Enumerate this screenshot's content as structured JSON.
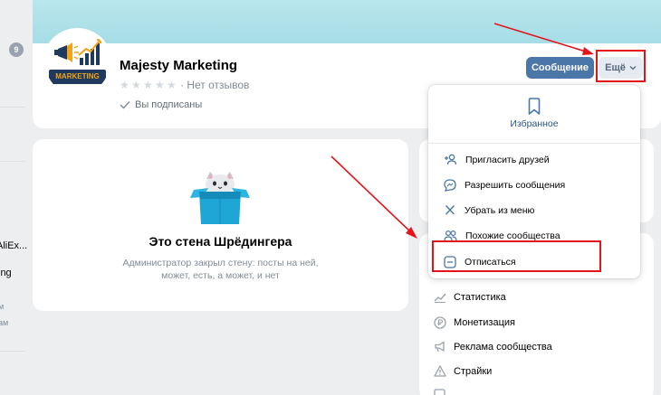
{
  "sidebar": {
    "badge": "9",
    "items": [
      {
        "text": "AliEx..."
      },
      {
        "text": "ing"
      },
      {
        "text": "м"
      },
      {
        "text": "ам"
      }
    ]
  },
  "group": {
    "title": "Majesty Marketing",
    "logo_text": "MARKETING",
    "reviews": "· Нет отзывов",
    "subscribed": "Вы подписаны",
    "rating_stars": 0
  },
  "buttons": {
    "message": "Сообщение",
    "more": "Ещё"
  },
  "wall": {
    "title": "Это стена Шрёдингера",
    "subtitle": "Администратор закрыл стену: посты на ней, может, есть, а может, и нет"
  },
  "dropdown": {
    "favorite": "Избранное",
    "items": [
      {
        "label": "Пригласить друзей",
        "icon": "add-user-icon"
      },
      {
        "label": "Разрешить сообщения",
        "icon": "message-icon"
      },
      {
        "label": "Убрать из меню",
        "icon": "close-icon"
      },
      {
        "label": "Похожие сообщества",
        "icon": "users-icon"
      },
      {
        "label": "Отписаться",
        "icon": "minus-square-icon"
      }
    ]
  },
  "manage_menu": {
    "items": [
      {
        "label": "Статистика",
        "icon": "stats-icon"
      },
      {
        "label": "Монетизация",
        "icon": "coin-icon"
      },
      {
        "label": "Реклама сообщества",
        "icon": "megaphone-icon"
      },
      {
        "label": "Страйки",
        "icon": "warning-icon"
      }
    ]
  },
  "colors": {
    "accent": "#4a76a8",
    "annotation": "#e3151a",
    "cover": "#a6dde6"
  }
}
